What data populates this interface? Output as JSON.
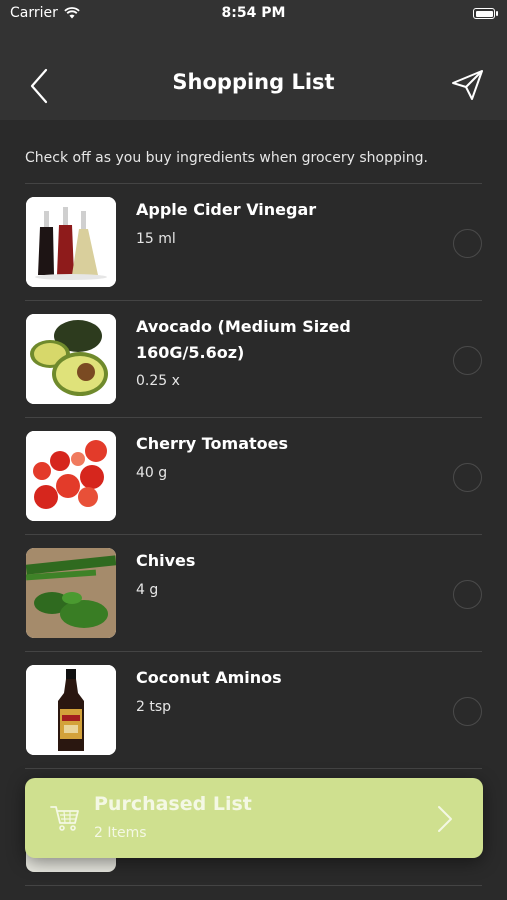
{
  "status_bar": {
    "carrier": "Carrier",
    "time": "8:54 PM"
  },
  "nav": {
    "title": "Shopping List",
    "back_icon": "chevron-left-icon",
    "send_icon": "paper-plane-icon"
  },
  "intro_text": "Check off as you buy ingredients when grocery shopping.",
  "items": [
    {
      "name": "Apple Cider Vinegar",
      "quantity": "15 ml",
      "checked": false,
      "image": "vinegar-bottles-image"
    },
    {
      "name": "Avocado (Medium Sized 160G/5.6oz)",
      "quantity": "0.25 x",
      "checked": false,
      "image": "avocado-image"
    },
    {
      "name": "Cherry Tomatoes",
      "quantity": "40 g",
      "checked": false,
      "image": "cherry-tomatoes-image"
    },
    {
      "name": "Chives",
      "quantity": "4 g",
      "checked": false,
      "image": "chives-image"
    },
    {
      "name": "Coconut Aminos",
      "quantity": "2 tsp",
      "checked": false,
      "image": "coconut-aminos-bottle-image"
    }
  ],
  "purchased": {
    "title": "Purchased List",
    "count": "2 Items",
    "icon": "shopping-cart-icon"
  },
  "colors": {
    "background": "#2a2a2a",
    "header": "#333333",
    "accent": "#cfe08f"
  }
}
